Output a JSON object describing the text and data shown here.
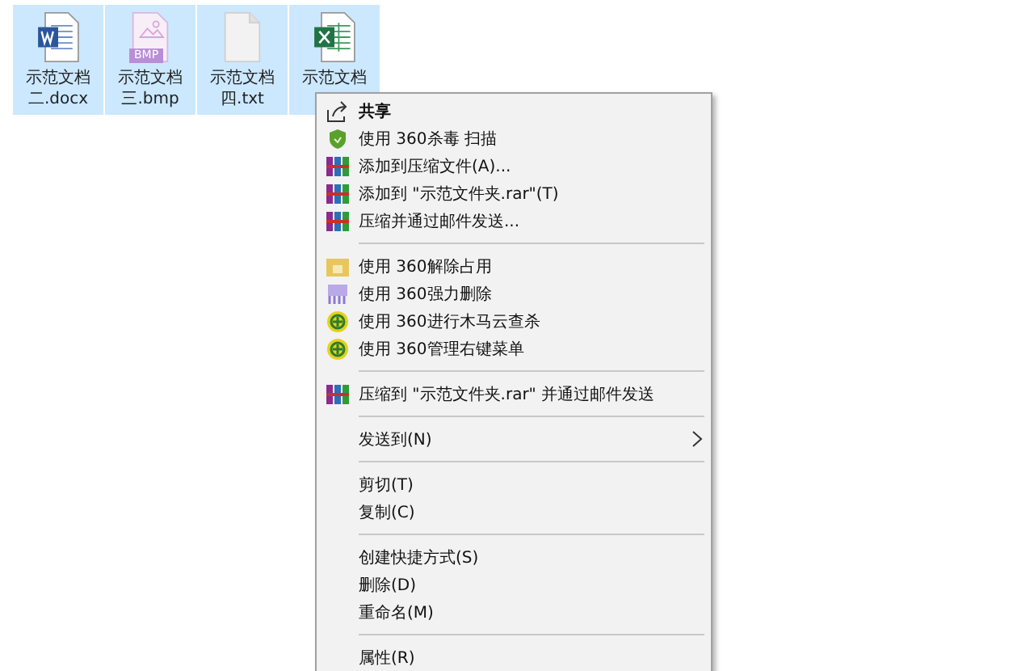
{
  "files": [
    {
      "name": "示范文档",
      "ext": "二.docx",
      "kind": "word",
      "selected": true
    },
    {
      "name": "示范文档",
      "ext": "三.bmp",
      "kind": "bmp",
      "badge": "BMP",
      "selected": true
    },
    {
      "name": "示范文档",
      "ext": "四.txt",
      "kind": "txt",
      "selected": true
    },
    {
      "name": "示范文档",
      "kind": "excel",
      "selected": true
    }
  ],
  "context_menu": {
    "items": [
      {
        "kind": "share",
        "label": "共享",
        "bold": true
      },
      {
        "kind": "shield",
        "label": "使用 360杀毒 扫描"
      },
      {
        "kind": "archive",
        "label": "添加到压缩文件(A)..."
      },
      {
        "kind": "archive",
        "label": "添加到 \"示范文件夹.rar\"(T)"
      },
      {
        "kind": "archive",
        "label": "压缩并通过邮件发送..."
      },
      {
        "kind": "separator"
      },
      {
        "kind": "unlock",
        "label": "使用 360解除占用"
      },
      {
        "kind": "shred",
        "label": "使用 360强力删除"
      },
      {
        "kind": "plus",
        "label": "使用 360进行木马云查杀"
      },
      {
        "kind": "plus",
        "label": "使用 360管理右键菜单"
      },
      {
        "kind": "separator"
      },
      {
        "kind": "archive",
        "label": "压缩到 \"示范文件夹.rar\" 并通过邮件发送"
      },
      {
        "kind": "separator"
      },
      {
        "kind": "plain",
        "label": "发送到(N)",
        "submenu": true
      },
      {
        "kind": "separator"
      },
      {
        "kind": "plain",
        "label": "剪切(T)"
      },
      {
        "kind": "plain",
        "label": "复制(C)"
      },
      {
        "kind": "separator"
      },
      {
        "kind": "plain",
        "label": "创建快捷方式(S)"
      },
      {
        "kind": "plain",
        "label": "删除(D)"
      },
      {
        "kind": "plain",
        "label": "重命名(M)"
      },
      {
        "kind": "separator"
      },
      {
        "kind": "plain",
        "label": "属性(R)"
      }
    ]
  }
}
